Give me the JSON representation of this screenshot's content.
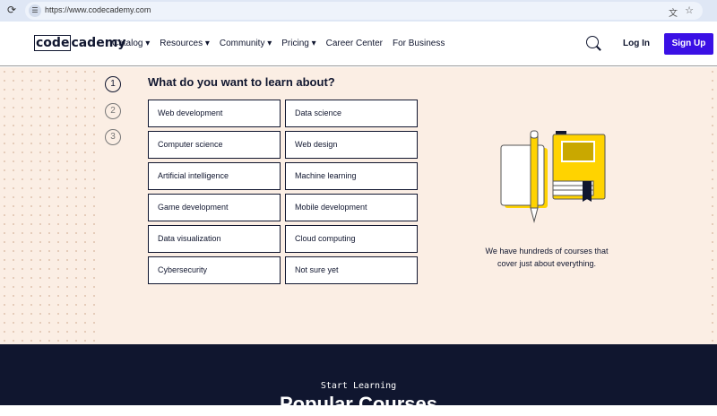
{
  "browser": {
    "url": "https://www.codecademy.com"
  },
  "nav": {
    "logo": {
      "box": "code",
      "rest": "cademy"
    },
    "items": [
      "Catalog ▾",
      "Resources ▾",
      "Community ▾",
      "Pricing ▾",
      "Career Center",
      "For Business"
    ],
    "login": "Log In",
    "signup": "Sign Up"
  },
  "quiz": {
    "steps": [
      "1",
      "2",
      "3"
    ],
    "question": "What do you want to learn about?",
    "options": [
      "Web development",
      "Data science",
      "Computer science",
      "Web design",
      "Artificial intelligence",
      "Machine learning",
      "Game development",
      "Mobile development",
      "Data visualization",
      "Cloud computing",
      "Cybersecurity",
      "Not sure yet"
    ],
    "caption": "We have hundreds of courses that cover just about everything."
  },
  "popular": {
    "eyebrow": "Start Learning",
    "title": "Popular Courses"
  },
  "colors": {
    "accent": "#3a10e5",
    "navy": "#10162f",
    "cream": "#fbeee4",
    "yellow": "#ffd300"
  }
}
